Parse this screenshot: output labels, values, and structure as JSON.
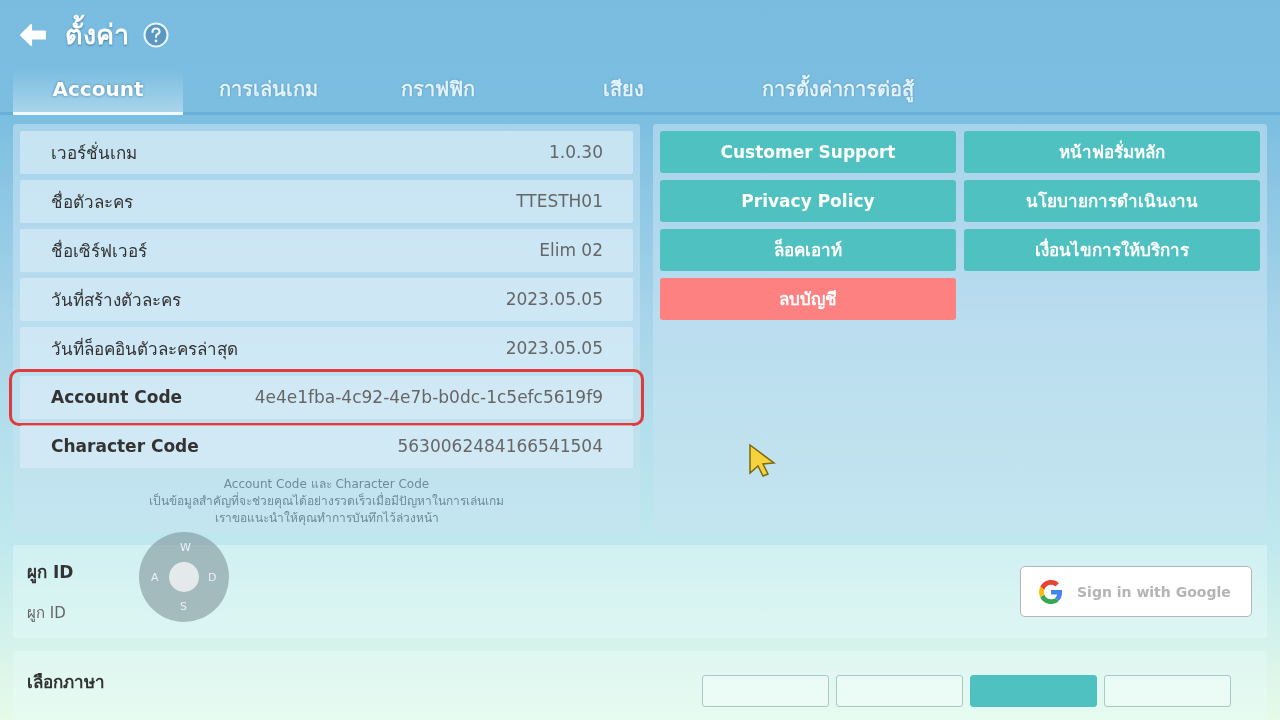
{
  "header": {
    "title": "ตั้งค่า"
  },
  "tabs": [
    {
      "label": "Account",
      "selected": true
    },
    {
      "label": "การเล่นเกม",
      "selected": false
    },
    {
      "label": "กราฟฟิก",
      "selected": false
    },
    {
      "label": "เสียง",
      "selected": false
    },
    {
      "label": "การตั้งค่าการต่อสู้",
      "selected": false
    }
  ],
  "info_rows": [
    {
      "label": "เวอร์ชั่นเกม",
      "value": "1.0.30",
      "kind": "thai",
      "highlighted": false
    },
    {
      "label": "ชื่อตัวละคร",
      "value": "TTESTH01",
      "kind": "thai",
      "highlighted": false
    },
    {
      "label": "ชื่อเซิร์ฟเวอร์",
      "value": "Elim 02",
      "kind": "thai",
      "highlighted": false
    },
    {
      "label": "วันที่สร้างตัวละคร",
      "value": "2023.05.05",
      "kind": "thai",
      "highlighted": false
    },
    {
      "label": "วันที่ล็อคอินตัวละครล่าสุด",
      "value": "2023.05.05",
      "kind": "thai",
      "highlighted": false
    },
    {
      "label": "Account Code",
      "value": "4e4e1fba-4c92-4e7b-b0dc-1c5efc5619f9",
      "kind": "code",
      "highlighted": true
    },
    {
      "label": "Character Code",
      "value": "5630062484166541504",
      "kind": "code",
      "highlighted": false
    }
  ],
  "note": [
    "Account Code และ Character Code",
    "เป็นข้อมูลสำคัญที่จะช่วยคุณได้อย่างรวดเร็วเมื่อมีปัญหาในการเล่นเกม",
    "เราขอแนะนำให้คุณทำการบันทึกไว้ล่วงหน้า"
  ],
  "action_buttons": [
    {
      "label": "Customer Support",
      "kind": "normal"
    },
    {
      "label": "หน้าฟอรั่มหลัก",
      "kind": "normal"
    },
    {
      "label": "Privacy Policy",
      "kind": "normal"
    },
    {
      "label": "นโยบายการดำเนินงาน",
      "kind": "normal"
    },
    {
      "label": "ล็อคเอาท์",
      "kind": "normal"
    },
    {
      "label": "เงื่อนไขการให้บริการ",
      "kind": "normal"
    },
    {
      "label": "ลบบัญชี",
      "kind": "danger"
    }
  ],
  "bind_section": {
    "title": "ผูก ID",
    "subtitle": "ผูก ID",
    "google_button": "Sign in with Google"
  },
  "language_section": {
    "title": "เลือกภาษา",
    "options": [
      {
        "selected": false
      },
      {
        "selected": false
      },
      {
        "selected": true
      },
      {
        "selected": false
      }
    ]
  },
  "joystick": {
    "keys": [
      "W",
      "A",
      "S",
      "D"
    ]
  }
}
